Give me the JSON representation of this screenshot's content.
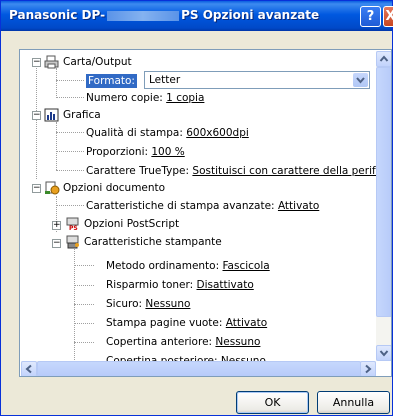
{
  "window": {
    "title_prefix": "Panasonic DP-",
    "title_suffix": "PS Opzioni avanzate",
    "help_glyph": "?",
    "close_glyph": "X"
  },
  "tree": {
    "paper_output": {
      "label": "Carta/Output",
      "format": {
        "label": "Formato:",
        "value": "Letter"
      },
      "copies": {
        "label": "Numero copie:",
        "value": "1 copia"
      }
    },
    "graphics": {
      "label": "Grafica",
      "quality": {
        "label": "Qualità di stampa:",
        "value": "600x600dpi"
      },
      "scaling": {
        "label": "Proporzioni:",
        "value": "100 %"
      },
      "truetype": {
        "label": "Carattere TrueType:",
        "value": "Sostituisci con carattere della periferica"
      }
    },
    "document_options": {
      "label": "Opzioni documento",
      "advanced_features": {
        "label": "Caratteristiche di stampa avanzate:",
        "value": "Attivato"
      },
      "postscript": {
        "label": "Opzioni PostScript"
      },
      "printer_features": {
        "label": "Caratteristiche stampante",
        "items": [
          {
            "label": "Metodo ordinamento:",
            "value": "Fascicola"
          },
          {
            "label": "Risparmio toner:",
            "value": "Disattivato"
          },
          {
            "label": "Sicuro:",
            "value": "Nessuno"
          },
          {
            "label": "Stampa pagine vuote:",
            "value": "Attivato"
          },
          {
            "label": "Copertina anteriore:",
            "value": "Nessuno"
          },
          {
            "label": "Copertina posteriore:",
            "value": "Nessuno"
          }
        ]
      }
    }
  },
  "buttons": {
    "ok": "OK",
    "cancel": "Annulla"
  },
  "icons": {
    "printer": "printer-icon",
    "graphics": "chart-icon",
    "document": "document-options-icon",
    "postscript": "postscript-icon",
    "features": "printer-features-icon"
  },
  "colors": {
    "titlebar": "#0058e0",
    "selection": "#316ac5",
    "window_bg": "#ece9d8"
  }
}
